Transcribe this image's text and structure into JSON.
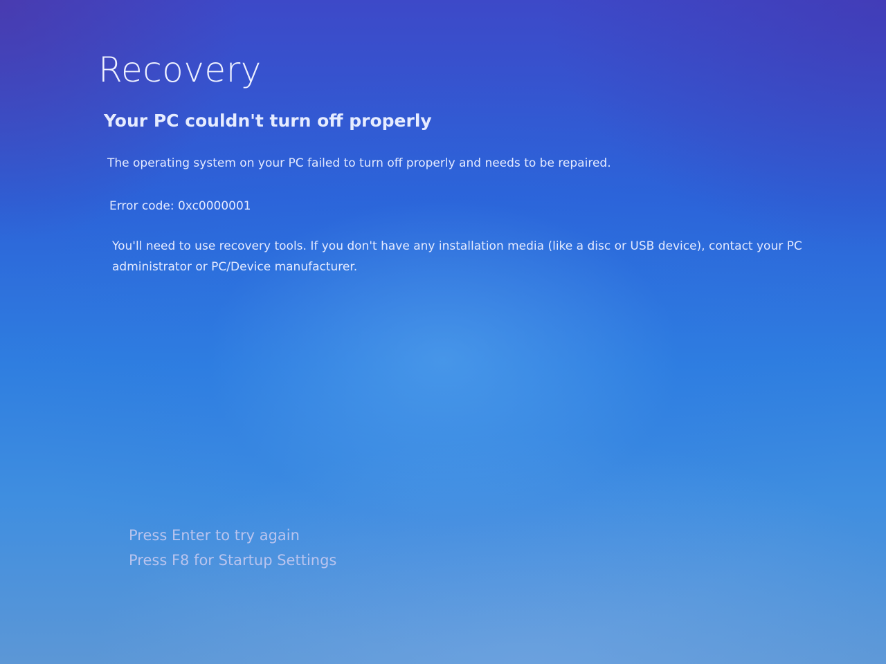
{
  "recovery": {
    "title": "Recovery",
    "subtitle": "Your PC couldn't turn off properly",
    "description": "The operating system on your PC failed to turn off properly and needs to be repaired.",
    "error_code": "Error code: 0xc0000001",
    "instructions": "You'll need to use recovery tools. If you don't have any installation media (like a disc or USB device), contact your PC administrator or PC/Device manufacturer."
  },
  "options": {
    "retry": "Press Enter to try again",
    "startup_settings": "Press F8 for Startup Settings"
  },
  "colors": {
    "background": "#2f6fdc",
    "text": "#ffffff",
    "option_text": "#b9c4ee"
  }
}
